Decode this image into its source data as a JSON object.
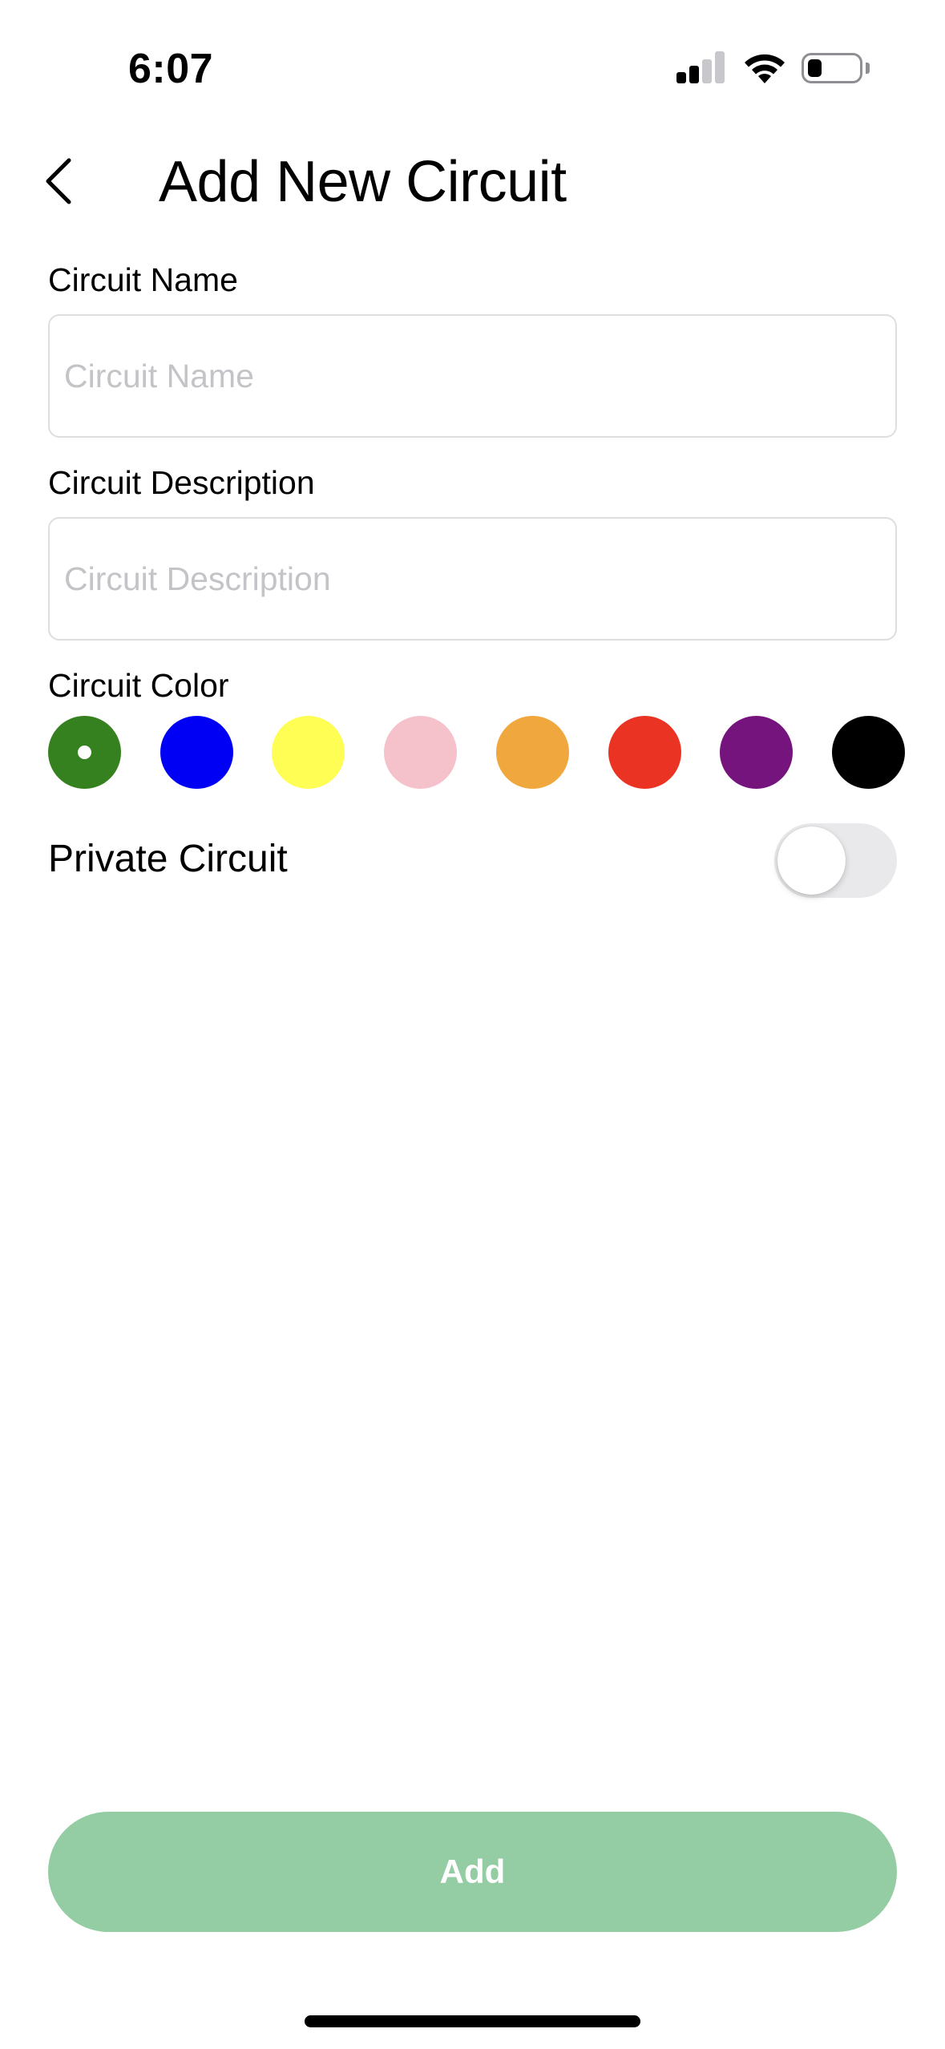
{
  "status_bar": {
    "time": "6:07",
    "signal_icon": "cellular-signal-icon",
    "wifi_icon": "wifi-icon",
    "battery_icon": "battery-icon",
    "battery_level": 0.2
  },
  "header": {
    "back_icon": "chevron-left-icon",
    "title": "Add New Circuit"
  },
  "form": {
    "name": {
      "label": "Circuit Name",
      "placeholder": "Circuit Name",
      "value": ""
    },
    "description": {
      "label": "Circuit Description",
      "placeholder": "Circuit Description",
      "value": ""
    },
    "color": {
      "label": "Circuit Color",
      "selected_index": 0,
      "options": [
        {
          "name": "green",
          "hex": "#35801f"
        },
        {
          "name": "blue",
          "hex": "#0000f5"
        },
        {
          "name": "yellow",
          "hex": "#fefe54"
        },
        {
          "name": "pink",
          "hex": "#f5c2cb"
        },
        {
          "name": "orange",
          "hex": "#f0a83e"
        },
        {
          "name": "red",
          "hex": "#ea3323"
        },
        {
          "name": "purple",
          "hex": "#75147c"
        },
        {
          "name": "black",
          "hex": "#000000"
        }
      ]
    },
    "private": {
      "label": "Private Circuit",
      "enabled": false
    }
  },
  "actions": {
    "add_label": "Add",
    "add_color": "#94cda4"
  }
}
